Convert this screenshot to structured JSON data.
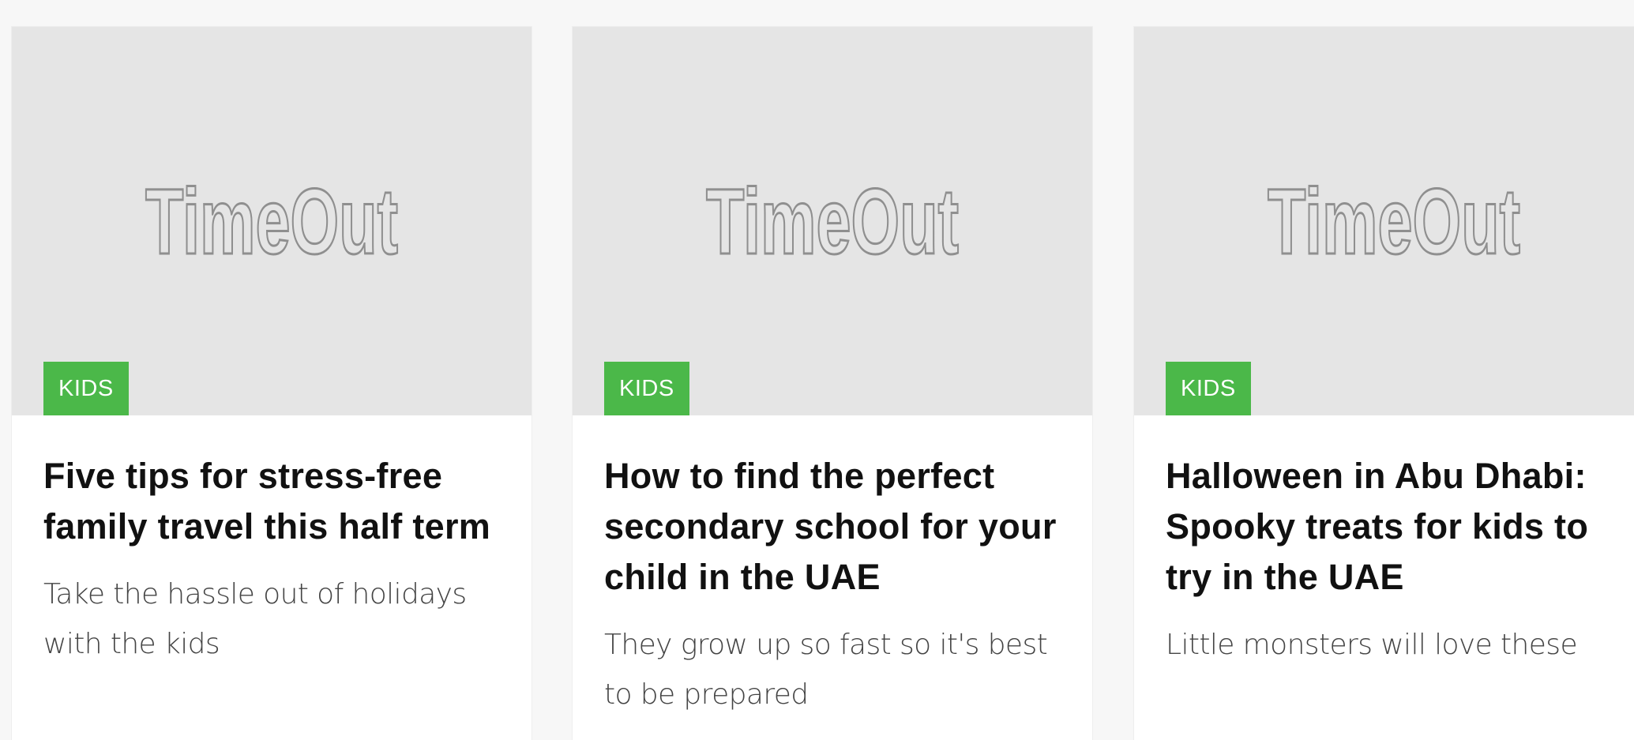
{
  "brand": {
    "logo_text": "TimeOut"
  },
  "colors": {
    "page_background": "#f7f7f7",
    "image_placeholder": "#e5e5e5",
    "tag_background": "#4bb849",
    "headline": "#111111",
    "excerpt": "#444444"
  },
  "cards": [
    {
      "tag": "KIDS",
      "headline": "Five tips for stress-free family travel this half term",
      "excerpt": "Take the hassle out of holidays with the kids"
    },
    {
      "tag": "KIDS",
      "headline": "How to find the perfect secondary school for your child in the UAE",
      "excerpt": "They grow up so fast so it's best to be prepared"
    },
    {
      "tag": "KIDS",
      "headline": "Halloween in Abu Dhabi: Spooky treats for kids to try in the UAE",
      "excerpt": "Little monsters will love these"
    }
  ]
}
